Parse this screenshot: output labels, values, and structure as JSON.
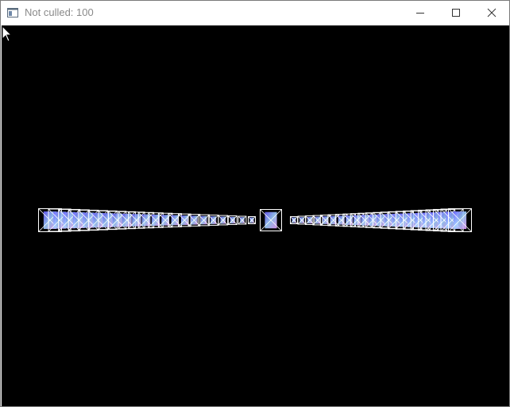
{
  "window": {
    "title": "Not culled: 100",
    "controls": {
      "minimize_icon": "minimize-icon",
      "maximize_icon": "maximize-icon",
      "close_icon": "close-icon"
    }
  },
  "scene": {
    "background_color": "#000000",
    "wireframe_color": "#ffffff",
    "cube_gradient_colors": [
      "#6a5cff",
      "#9fd0ff",
      "#e8a0ff"
    ]
  },
  "cursor": {
    "icon": "mouse-pointer-icon"
  }
}
